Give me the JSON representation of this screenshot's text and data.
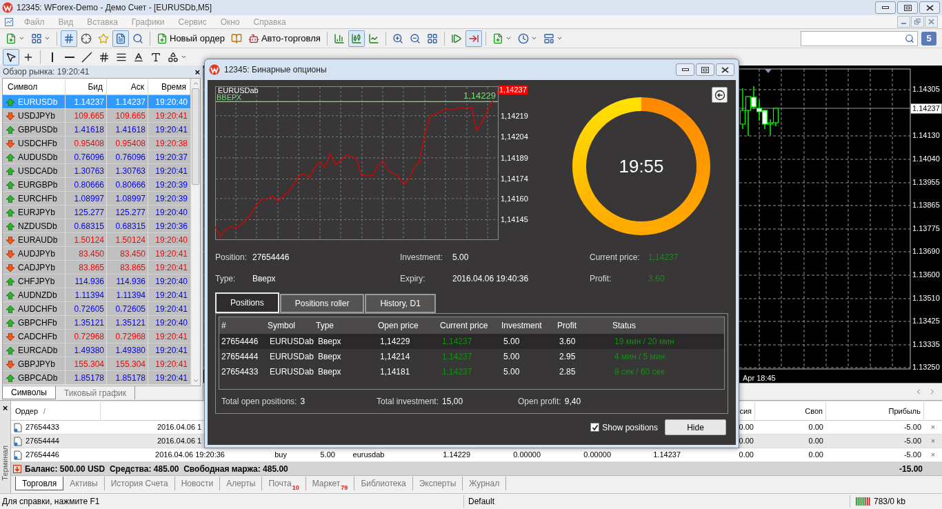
{
  "window": {
    "title": "12345: WForex-Demo - Демо Счет - [EURUSDb,M5]"
  },
  "menu": [
    {
      "label": "Файл",
      "disabled": true
    },
    {
      "label": "Вид",
      "disabled": true
    },
    {
      "label": "Вставка",
      "disabled": true
    },
    {
      "label": "Графики",
      "disabled": true
    },
    {
      "label": "Сервис",
      "disabled": true
    },
    {
      "label": "Окно",
      "disabled": true
    },
    {
      "label": "Справка",
      "disabled": true
    }
  ],
  "toolbar": {
    "items": [
      {
        "kind": "new-chart",
        "selected": false
      },
      {
        "kind": "profiles",
        "selected": false
      },
      {
        "kind": "sep"
      },
      {
        "kind": "market-watch",
        "selected": true
      },
      {
        "kind": "navigator",
        "selected": false
      },
      {
        "kind": "favorites",
        "selected": false
      },
      {
        "kind": "data-window",
        "selected": true
      },
      {
        "kind": "tester",
        "selected": false
      },
      {
        "kind": "sep"
      },
      {
        "kind": "new-order",
        "label": "Новый ордер",
        "selected": false
      },
      {
        "kind": "editor",
        "selected": false
      },
      {
        "kind": "auto-trading",
        "label": "Авто-торговля",
        "selected": false
      },
      {
        "kind": "sep"
      },
      {
        "kind": "bars",
        "selected": false
      },
      {
        "kind": "candles",
        "selected": true
      },
      {
        "kind": "line",
        "selected": false
      },
      {
        "kind": "sep"
      },
      {
        "kind": "zoom-in",
        "selected": false
      },
      {
        "kind": "zoom-out",
        "selected": false
      },
      {
        "kind": "tile",
        "selected": false
      },
      {
        "kind": "sep"
      },
      {
        "kind": "shift",
        "selected": false
      },
      {
        "kind": "autoscroll",
        "selected": true
      },
      {
        "kind": "sep"
      },
      {
        "kind": "indicators",
        "selected": false
      },
      {
        "kind": "periods",
        "selected": false
      },
      {
        "kind": "templates",
        "selected": false
      }
    ],
    "badge": "5"
  },
  "tools": [
    {
      "kind": "cursor",
      "selected": true
    },
    {
      "kind": "crosshair",
      "selected": false
    },
    {
      "kind": "sep"
    },
    {
      "kind": "vline",
      "selected": false
    },
    {
      "kind": "hline",
      "selected": false
    },
    {
      "kind": "trend",
      "selected": false
    },
    {
      "kind": "channel",
      "selected": false
    },
    {
      "kind": "fibo",
      "selected": false
    },
    {
      "kind": "text",
      "selected": false
    },
    {
      "kind": "label",
      "selected": false
    },
    {
      "kind": "arrows",
      "selected": false
    }
  ],
  "market_watch": {
    "title": "Обзор рынка: 19:20:41",
    "close": "×",
    "columns": [
      "Символ",
      "Бид",
      "Аск",
      "Время"
    ],
    "rows": [
      {
        "symbol": "EURUSDb",
        "bid": "1.14237",
        "ask": "1.14237",
        "time": "19:20:40",
        "kind": "up",
        "selected": true
      },
      {
        "symbol": "USDJPYb",
        "bid": "109.665",
        "ask": "109.665",
        "time": "19:20:41",
        "kind": "down",
        "selected": false
      },
      {
        "symbol": "GBPUSDb",
        "bid": "1.41618",
        "ask": "1.41618",
        "time": "19:20:41",
        "kind": "up",
        "selected": false
      },
      {
        "symbol": "USDCHFb",
        "bid": "0.95408",
        "ask": "0.95408",
        "time": "19:20:38",
        "kind": "down",
        "selected": false
      },
      {
        "symbol": "AUDUSDb",
        "bid": "0.76096",
        "ask": "0.76096",
        "time": "19:20:37",
        "kind": "up",
        "selected": false
      },
      {
        "symbol": "USDCADb",
        "bid": "1.30763",
        "ask": "1.30763",
        "time": "19:20:41",
        "kind": "up",
        "selected": false
      },
      {
        "symbol": "EURGBPb",
        "bid": "0.80666",
        "ask": "0.80666",
        "time": "19:20:39",
        "kind": "up",
        "selected": false
      },
      {
        "symbol": "EURCHFb",
        "bid": "1.08997",
        "ask": "1.08997",
        "time": "19:20:39",
        "kind": "up",
        "selected": false
      },
      {
        "symbol": "EURJPYb",
        "bid": "125.277",
        "ask": "125.277",
        "time": "19:20:40",
        "kind": "up",
        "selected": false
      },
      {
        "symbol": "NZDUSDb",
        "bid": "0.68315",
        "ask": "0.68315",
        "time": "19:20:36",
        "kind": "up",
        "selected": false
      },
      {
        "symbol": "EURAUDb",
        "bid": "1.50124",
        "ask": "1.50124",
        "time": "19:20:40",
        "kind": "down",
        "selected": false
      },
      {
        "symbol": "AUDJPYb",
        "bid": "83.450",
        "ask": "83.450",
        "time": "19:20:41",
        "kind": "down",
        "selected": false
      },
      {
        "symbol": "CADJPYb",
        "bid": "83.865",
        "ask": "83.865",
        "time": "19:20:41",
        "kind": "down",
        "selected": false
      },
      {
        "symbol": "CHFJPYb",
        "bid": "114.936",
        "ask": "114.936",
        "time": "19:20:40",
        "kind": "up",
        "selected": false
      },
      {
        "symbol": "AUDNZDb",
        "bid": "1.11394",
        "ask": "1.11394",
        "time": "19:20:41",
        "kind": "up",
        "selected": false
      },
      {
        "symbol": "AUDCHFb",
        "bid": "0.72605",
        "ask": "0.72605",
        "time": "19:20:41",
        "kind": "up",
        "selected": false
      },
      {
        "symbol": "GBPCHFb",
        "bid": "1.35121",
        "ask": "1.35121",
        "time": "19:20:40",
        "kind": "up",
        "selected": false
      },
      {
        "symbol": "CADCHFb",
        "bid": "0.72968",
        "ask": "0.72968",
        "time": "19:20:41",
        "kind": "down",
        "selected": false
      },
      {
        "symbol": "EURCADb",
        "bid": "1.49380",
        "ask": "1.49380",
        "time": "19:20:41",
        "kind": "up",
        "selected": false
      },
      {
        "symbol": "GBPJPYb",
        "bid": "155.304",
        "ask": "155.304",
        "time": "19:20:41",
        "kind": "down",
        "selected": false
      },
      {
        "symbol": "GBPCADb",
        "bid": "1.85178",
        "ask": "1.85178",
        "time": "19:20:41",
        "kind": "up",
        "selected": false
      }
    ],
    "tabs": [
      {
        "label": "Символы",
        "selected": true
      },
      {
        "label": "Тиковый график",
        "selected": false
      }
    ]
  },
  "chart": {
    "price_axis": [
      "1.14305",
      "1.14130",
      "1.14040",
      "1.13955",
      "1.13865",
      "1.13775",
      "1.13690",
      "1.13600",
      "1.13510",
      "1.13425",
      "1.13335",
      "1.13250"
    ],
    "current_price": "1.14237",
    "time_label": "Apr 18:45"
  },
  "dialog": {
    "title": "12345: Бинарные опционы",
    "chart": {
      "title": "EURUSDab",
      "axis_labels": [
        "1,14219",
        "1,14204",
        "1,14189",
        "1,14174",
        "1,14160",
        "1,14145"
      ],
      "level_text": "ВВЕРХ",
      "level_value": "1,14229",
      "price_tag": "1,14237"
    },
    "timer": "19:55",
    "info": [
      {
        "label": "Position:",
        "value": "27654446",
        "kind": "plain"
      },
      {
        "label": "Investment:",
        "value": "5.00",
        "kind": "plain"
      },
      {
        "label": "Current price:",
        "value": "1,14237",
        "kind": "positive"
      },
      {
        "label": "Type:",
        "value": "Вверх",
        "kind": "plain"
      },
      {
        "label": "Expiry:",
        "value": "2016.04.06 19:40:36",
        "kind": "plain"
      },
      {
        "label": "Profit:",
        "value": "3.60",
        "kind": "positive"
      }
    ],
    "tabs": [
      {
        "label": "Positions",
        "selected": true
      },
      {
        "label": "Positions roller",
        "selected": false
      },
      {
        "label": "History, D1",
        "selected": false
      }
    ],
    "table": {
      "columns": [
        {
          "label": "#",
          "kind": "plain"
        },
        {
          "label": "Symbol",
          "kind": "plain"
        },
        {
          "label": "Type",
          "kind": "plain"
        },
        {
          "label": "Open price",
          "kind": "plain"
        },
        {
          "label": "Current price",
          "kind": "positive"
        },
        {
          "label": "Investment",
          "kind": "plain"
        },
        {
          "label": "Profit",
          "kind": "plain"
        },
        {
          "label": "Status",
          "kind": "positive"
        }
      ],
      "rows": [
        {
          "cells": [
            "27654446",
            "EURUSDab",
            "Вверх",
            "1,14229",
            "1,14237",
            "5.00",
            "3.60",
            "19 мин / 20 мин"
          ],
          "selected": true
        },
        {
          "cells": [
            "27654444",
            "EURUSDab",
            "Вверх",
            "1,14214",
            "1,14237",
            "5.00",
            "2.95",
            "4 мин / 5 мин"
          ],
          "selected": false
        },
        {
          "cells": [
            "27654433",
            "EURUSDab",
            "Вверх",
            "1,14181",
            "1,14237",
            "5.00",
            "2.85",
            "8 сек / 60 сек"
          ],
          "selected": false
        }
      ]
    },
    "totals": [
      {
        "label": "Total open positions:",
        "value": "3"
      },
      {
        "label": "Total investment:",
        "value": "15,00"
      },
      {
        "label": "Open profit:",
        "value": "9,40"
      }
    ],
    "show_positions": {
      "label": "Show positions",
      "checked": true
    },
    "hide_button": "Hide"
  },
  "terminal": {
    "label": "Терминал",
    "close": "×",
    "order_header": "Ордер",
    "sort_mark": "/",
    "headers": [
      "сия",
      "Своп",
      "Прибыль"
    ],
    "rows": [
      {
        "order": "27654433",
        "time": "2016.04.06 1",
        "commission": "0.00",
        "swap": "0.00",
        "profit": "-5.00",
        "close": "×"
      },
      {
        "order": "27654444",
        "time": "2016.04.06 1",
        "commission": "0.00",
        "swap": "0.00",
        "profit": "-5.00",
        "close": "×"
      },
      {
        "order": "27654446",
        "time": "2016.04.06 19:20:36",
        "type": "buy",
        "volume": "5.00",
        "symbol": "eurusdab",
        "price": "1.14229",
        "sl": "0.00000",
        "tp": "0.00000",
        "current": "1.14237",
        "commission": "0.00",
        "swap": "0.00",
        "profit": "-5.00",
        "close": "×"
      }
    ],
    "balance": "Баланс: 500.00 USD  Средства: 485.00  Свободная маржа: 485.00",
    "total": "-15.00",
    "tabs": [
      {
        "label": "Торговля",
        "selected": true
      },
      {
        "label": "Активы",
        "selected": false
      },
      {
        "label": "История Счета",
        "selected": false
      },
      {
        "label": "Новости",
        "selected": false
      },
      {
        "label": "Алерты",
        "selected": false
      },
      {
        "label": "Почта",
        "badge": "10",
        "selected": false
      },
      {
        "label": "Маркет",
        "badge": "79",
        "selected": false
      },
      {
        "label": "Библиотека",
        "selected": false
      },
      {
        "label": "Эксперты",
        "selected": false
      },
      {
        "label": "Журнал",
        "selected": false
      }
    ]
  },
  "status_bar": {
    "help": "Для справки, нажмите F1",
    "profile": "Default",
    "traffic": "783/0 kb"
  }
}
